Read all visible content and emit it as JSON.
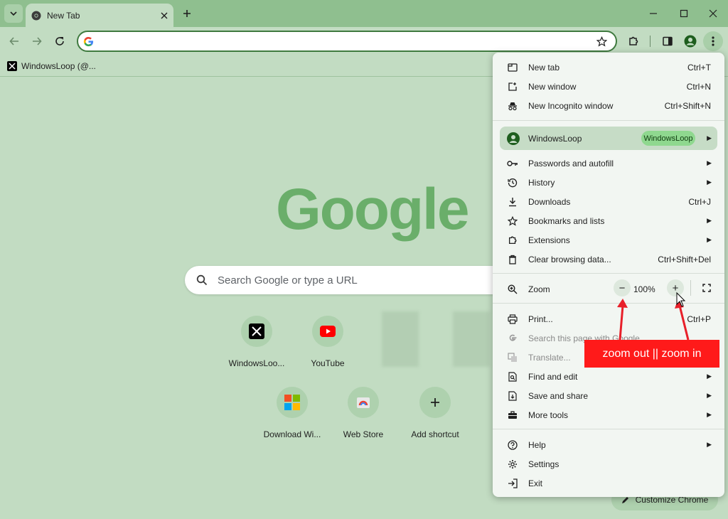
{
  "window": {
    "tab_title": "New Tab"
  },
  "toolbar": {
    "omnibox_value": ""
  },
  "bookmarks_bar": {
    "items": [
      {
        "label": "WindowsLoop (@..."
      }
    ]
  },
  "ntp": {
    "logo_text": "Google",
    "search_placeholder": "Search Google or type a URL",
    "shortcuts": [
      {
        "label": "WindowsLoo..."
      },
      {
        "label": "YouTube"
      },
      {
        "label": "Download Wi..."
      },
      {
        "label": "Web Store"
      },
      {
        "label": "Add shortcut"
      }
    ],
    "customize_label": "Customize Chrome"
  },
  "menu": {
    "new_tab": {
      "label": "New tab",
      "shortcut": "Ctrl+T"
    },
    "new_window": {
      "label": "New window",
      "shortcut": "Ctrl+N"
    },
    "new_incognito": {
      "label": "New Incognito window",
      "shortcut": "Ctrl+Shift+N"
    },
    "profile": {
      "name": "WindowsLoop",
      "badge": "WindowsLoop"
    },
    "passwords": {
      "label": "Passwords and autofill"
    },
    "history": {
      "label": "History"
    },
    "downloads": {
      "label": "Downloads",
      "shortcut": "Ctrl+J"
    },
    "bookmarks": {
      "label": "Bookmarks and lists"
    },
    "extensions": {
      "label": "Extensions"
    },
    "clear_data": {
      "label": "Clear browsing data...",
      "shortcut": "Ctrl+Shift+Del"
    },
    "zoom": {
      "label": "Zoom",
      "value": "100%",
      "minus": "−",
      "plus": "+"
    },
    "print": {
      "label": "Print...",
      "shortcut": "Ctrl+P"
    },
    "search_page": {
      "label": "Search this page with Google"
    },
    "translate": {
      "label": "Translate..."
    },
    "find_edit": {
      "label": "Find and edit"
    },
    "save_share": {
      "label": "Save and share"
    },
    "more_tools": {
      "label": "More tools"
    },
    "help": {
      "label": "Help"
    },
    "settings": {
      "label": "Settings"
    },
    "exit": {
      "label": "Exit"
    }
  },
  "annotation": {
    "callout_text": "zoom out || zoom in"
  },
  "colors": {
    "theme_green": "#8fbf8f",
    "page_bg": "#c2dcc2",
    "callout_red": "#ff1a1a"
  }
}
